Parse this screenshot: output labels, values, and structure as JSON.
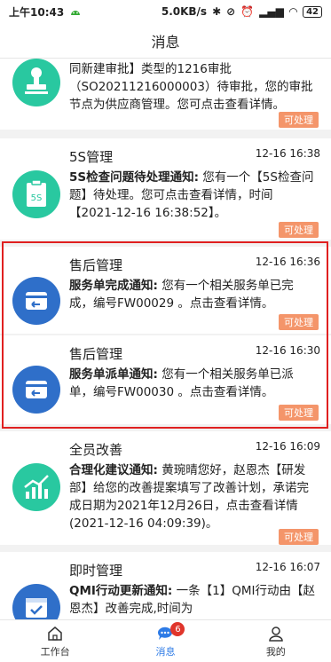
{
  "status": {
    "time": "上午10:43",
    "speed": "5.0KB/s",
    "battery": "42"
  },
  "header": {
    "title": "消息"
  },
  "messages": [
    {
      "title": "",
      "time": "",
      "bold": "",
      "text": "同新建审批】类型的1216审批（SO20211216000003）待审批，您的审批节点为供应商管理。您可点击查看详情。",
      "badge": "可处理"
    },
    {
      "title": "5S管理",
      "time": "12-16 16:38",
      "bold": "5S检查问题待处理通知:",
      "text": " 您有一个【5S检查问题】待处理。您可点击查看详情，时间【2021-12-16 16:38:52】。",
      "badge": "可处理"
    },
    {
      "title": "售后管理",
      "time": "12-16 16:36",
      "bold": "服务单完成通知:",
      "text": " 您有一个相关服务单已完成，编号FW00029 。点击查看详情。",
      "badge": "可处理"
    },
    {
      "title": "售后管理",
      "time": "12-16 16:30",
      "bold": "服务单派单通知:",
      "text": " 您有一个相关服务单已派单，编号FW00030 。点击查看详情。",
      "badge": "可处理"
    },
    {
      "title": "全员改善",
      "time": "12-16 16:09",
      "bold": "合理化建议通知:",
      "text": " 黄琬晴您好，赵恩杰【研发部】给您的改善提案填写了改善计划，承诺完成日期为2021年12月26日，点击查看详情(2021-12-16 04:09:39)。",
      "badge": "可处理"
    },
    {
      "title": "即时管理",
      "time": "12-16 16:07",
      "bold": "QMI行动更新通知:",
      "text": " 一条【1】QMI行动由【赵恩杰】改善完成,时间为",
      "badge": ""
    }
  ],
  "tabs": [
    {
      "label": "工作台"
    },
    {
      "label": "消息",
      "count": "6"
    },
    {
      "label": "我的"
    }
  ],
  "colors": {
    "teal": "#29c8a0",
    "blue": "#2f6fc9",
    "accent": "#2e7be6",
    "badge": "#f4956a",
    "highlight": "#e02020"
  }
}
